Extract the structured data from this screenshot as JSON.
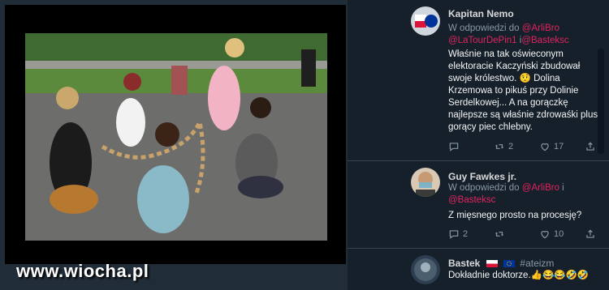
{
  "site": {
    "watermark": "www.wiocha.pl"
  },
  "tweets": [
    {
      "name": "Kapitan Nemo",
      "reply_prefix": "W odpowiedzi do",
      "mention1": "@ArliBro",
      "mention2": "@LaTourDePin1",
      "mention3": "i",
      "mention4": "@Basteksc",
      "text": "Właśnie na tak oświeconym elektoracie Kaczyński zbudował swoje królestwo. 🤨 Dolina Krzemowa to pikuś przy Dolinie Serdelkowej... A na gorączkę najlepsze są właśnie zdrowaśki plus gorący piec chlebny.",
      "retweets": "2",
      "likes": "17"
    },
    {
      "name": "Guy Fawkes jr.",
      "reply_prefix": "W odpowiedzi do",
      "mention1": "@ArliBro",
      "mention2": "i",
      "mention3": "@Basteksc",
      "text": "Z mięsnego prosto na procesję?",
      "replies": "2",
      "likes": "10"
    },
    {
      "name": "Bastek",
      "hashtag": "#ateizm",
      "text": "Dokładnie doktorze.",
      "emoji": "👍😂😂🤣🤣"
    }
  ],
  "icons": [
    "reply-icon",
    "retweet-icon",
    "like-icon",
    "share-icon"
  ],
  "colors": {
    "background": "#15202b",
    "mention": "#e0245e",
    "muted": "#8899a6",
    "text": "#f5f5f5"
  }
}
